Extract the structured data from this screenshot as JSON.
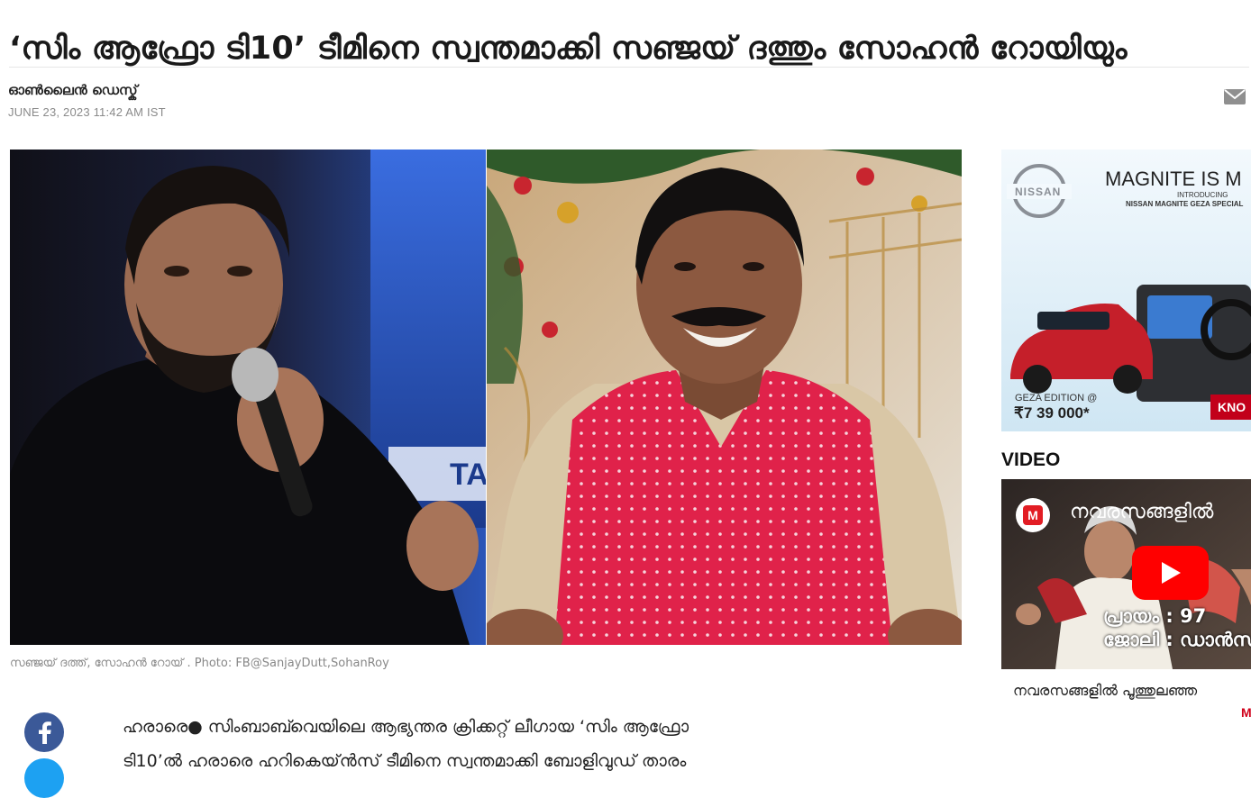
{
  "article": {
    "headline": "‘സിം ആഫ്രോ ടി10’ ടീമിനെ സ്വന്തമാക്കി സഞ്ജയ് ദത്തും സോഹൻ റോയിയും",
    "author": "ഓൺലൈൻ ഡെസ്ക്",
    "date": "JUNE 23, 2023 11:42 AM IST",
    "photo_caption": "സഞ്ജയ് ദത്ത്, സോഹൻ റോയ് . Photo: FB@SanjayDutt,SohanRoy",
    "body_line1": "ഹരാരെ● സിംബാബ്‍വെയിലെ ആഭ്യന്തര ക്രിക്കറ്റ് ലീഗായ ‘സിം ആഫ്രോ",
    "body_line2": "ടി10’ൽ ഹരാരെ ഹറികെയ്ൻസ് ടീമിനെ സ്വന്തമാക്കി ബോളിവുഡ് താരം"
  },
  "ad": {
    "brand": "NISSAN",
    "headline": "MAGNITE IS M",
    "introducing": "INTRODUCING",
    "sub": "NISSAN MAGNITE GEZA SPECIAL",
    "edition": "GEZA EDITION @",
    "price": "₹7 39 000*",
    "cta": "KNO"
  },
  "sidebar": {
    "video_label": "VIDEO",
    "video_overlay_title": "നവരസങ്ങളിൽ",
    "video_overlay_line1": "പ്രായം : 97",
    "video_overlay_line2": "ജോലി : ഡാൻസ",
    "video_title": "നവരസങ്ങളിൽ പൂത്തുലഞ്ഞ",
    "more_marker": "M"
  },
  "icons": {
    "mail": "mail-icon",
    "facebook": "facebook-icon",
    "play": "play-icon",
    "channel_logo": "manorama-logo-icon"
  },
  "colors": {
    "facebook": "#3b5998",
    "play_button": "#ff0000",
    "vest": "#e0224a",
    "accent_red": "#d0021b"
  }
}
